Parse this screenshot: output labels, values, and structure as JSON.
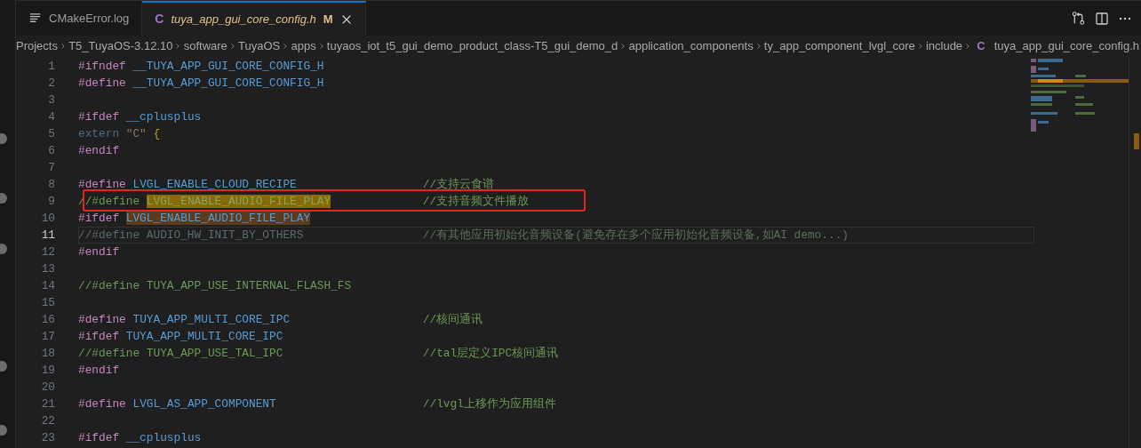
{
  "tabs": [
    {
      "label": "CMakeError.log",
      "kind": "log",
      "selected": false
    },
    {
      "label": "tuya_app_gui_core_config.h",
      "kind": "c",
      "icon": "C",
      "selected": true,
      "status": "M"
    }
  ],
  "breadcrumb": [
    {
      "label": "Projects"
    },
    {
      "label": "T5_TuyaOS-3.12.10"
    },
    {
      "label": "software"
    },
    {
      "label": "TuyaOS"
    },
    {
      "label": "apps"
    },
    {
      "label": "tuyaos_iot_t5_gui_demo_product_class-T5_gui_demo_d"
    },
    {
      "label": "application_components"
    },
    {
      "label": "ty_app_component_lvgl_core"
    },
    {
      "label": "include"
    },
    {
      "label": "tuya_app_gui_core_config.h",
      "icon": "C"
    }
  ],
  "lines": [
    {
      "number": "1",
      "code": [
        {
          "text": "#ifndef",
          "kind": "directive"
        },
        {
          "text": "__TUYA_APP_GUI_CORE_CONFIG_H",
          "kind": "macro"
        }
      ]
    },
    {
      "number": "2",
      "code": [
        {
          "text": "#define",
          "kind": "directive"
        },
        {
          "text": "__TUYA_APP_GUI_CORE_CONFIG_H",
          "kind": "macro"
        }
      ]
    },
    {
      "number": "3"
    },
    {
      "number": "4",
      "code": [
        {
          "text": "#ifdef",
          "kind": "directive"
        },
        {
          "text": "__cplusplus",
          "kind": "macro"
        }
      ]
    },
    {
      "number": "5",
      "code": [
        {
          "text": "extern",
          "kind": "inactive-keyword"
        },
        {
          "text": "\"C\"",
          "kind": "string"
        },
        {
          "text": "{",
          "kind": "brace"
        }
      ]
    },
    {
      "number": "6",
      "code": [
        {
          "text": "#endif",
          "kind": "directive"
        }
      ]
    },
    {
      "number": "7"
    },
    {
      "number": "8",
      "code": [
        {
          "text": "#define",
          "kind": "directive"
        },
        {
          "text": "LVGL_ENABLE_CLOUD_RECIPE",
          "kind": "macro"
        }
      ],
      "comment": "//支持云食谱"
    },
    {
      "number": "9",
      "code": [
        {
          "text": "//#define",
          "kind": "comment"
        },
        {
          "text": "LVGL_ENABLE_AUDIO_FILE_PLAY",
          "kind": "comment",
          "highlighted": true
        }
      ],
      "comment": "//支持音频文件播放"
    },
    {
      "number": "10",
      "code": [
        {
          "text": "#ifdef",
          "kind": "directive"
        },
        {
          "text": "LVGL_ENABLE_AUDIO_FILE_PLAY",
          "kind": "macro",
          "highlighted": true
        }
      ]
    },
    {
      "number": "11",
      "current": true,
      "code": [
        {
          "text": "//#define AUDIO_HW_INIT_BY_OTHERS",
          "kind": "inactive"
        }
      ],
      "comment": "//有其他应用初始化音频设备(避免存在多个应用初始化音频设备,如AI demo...)",
      "comment_inactive": true
    },
    {
      "number": "12",
      "code": [
        {
          "text": "#endif",
          "kind": "directive"
        }
      ]
    },
    {
      "number": "13"
    },
    {
      "number": "14",
      "code": [
        {
          "text": "//#define TUYA_APP_USE_INTERNAL_FLASH_FS",
          "kind": "comment"
        }
      ]
    },
    {
      "number": "15"
    },
    {
      "number": "16",
      "code": [
        {
          "text": "#define",
          "kind": "directive"
        },
        {
          "text": "TUYA_APP_MULTI_CORE_IPC",
          "kind": "macro"
        }
      ],
      "comment": "//核间通讯"
    },
    {
      "number": "17",
      "code": [
        {
          "text": "#ifdef",
          "kind": "directive"
        },
        {
          "text": "TUYA_APP_MULTI_CORE_IPC",
          "kind": "macro"
        }
      ]
    },
    {
      "number": "18",
      "code": [
        {
          "text": "//#define TUYA_APP_USE_TAL_IPC",
          "kind": "comment"
        }
      ],
      "comment": "//tal层定义IPC核间通讯"
    },
    {
      "number": "19",
      "code": [
        {
          "text": "#endif",
          "kind": "directive"
        }
      ]
    },
    {
      "number": "20"
    },
    {
      "number": "21",
      "code": [
        {
          "text": "#define",
          "kind": "directive"
        },
        {
          "text": "LVGL_AS_APP_COMPONENT",
          "kind": "macro"
        }
      ],
      "comment": "//lvgl上移作为应用组件"
    },
    {
      "number": "22"
    },
    {
      "number": "23",
      "code": [
        {
          "text": "#ifdef",
          "kind": "directive"
        },
        {
          "text": "__cplusplus",
          "kind": "macro"
        }
      ]
    }
  ]
}
